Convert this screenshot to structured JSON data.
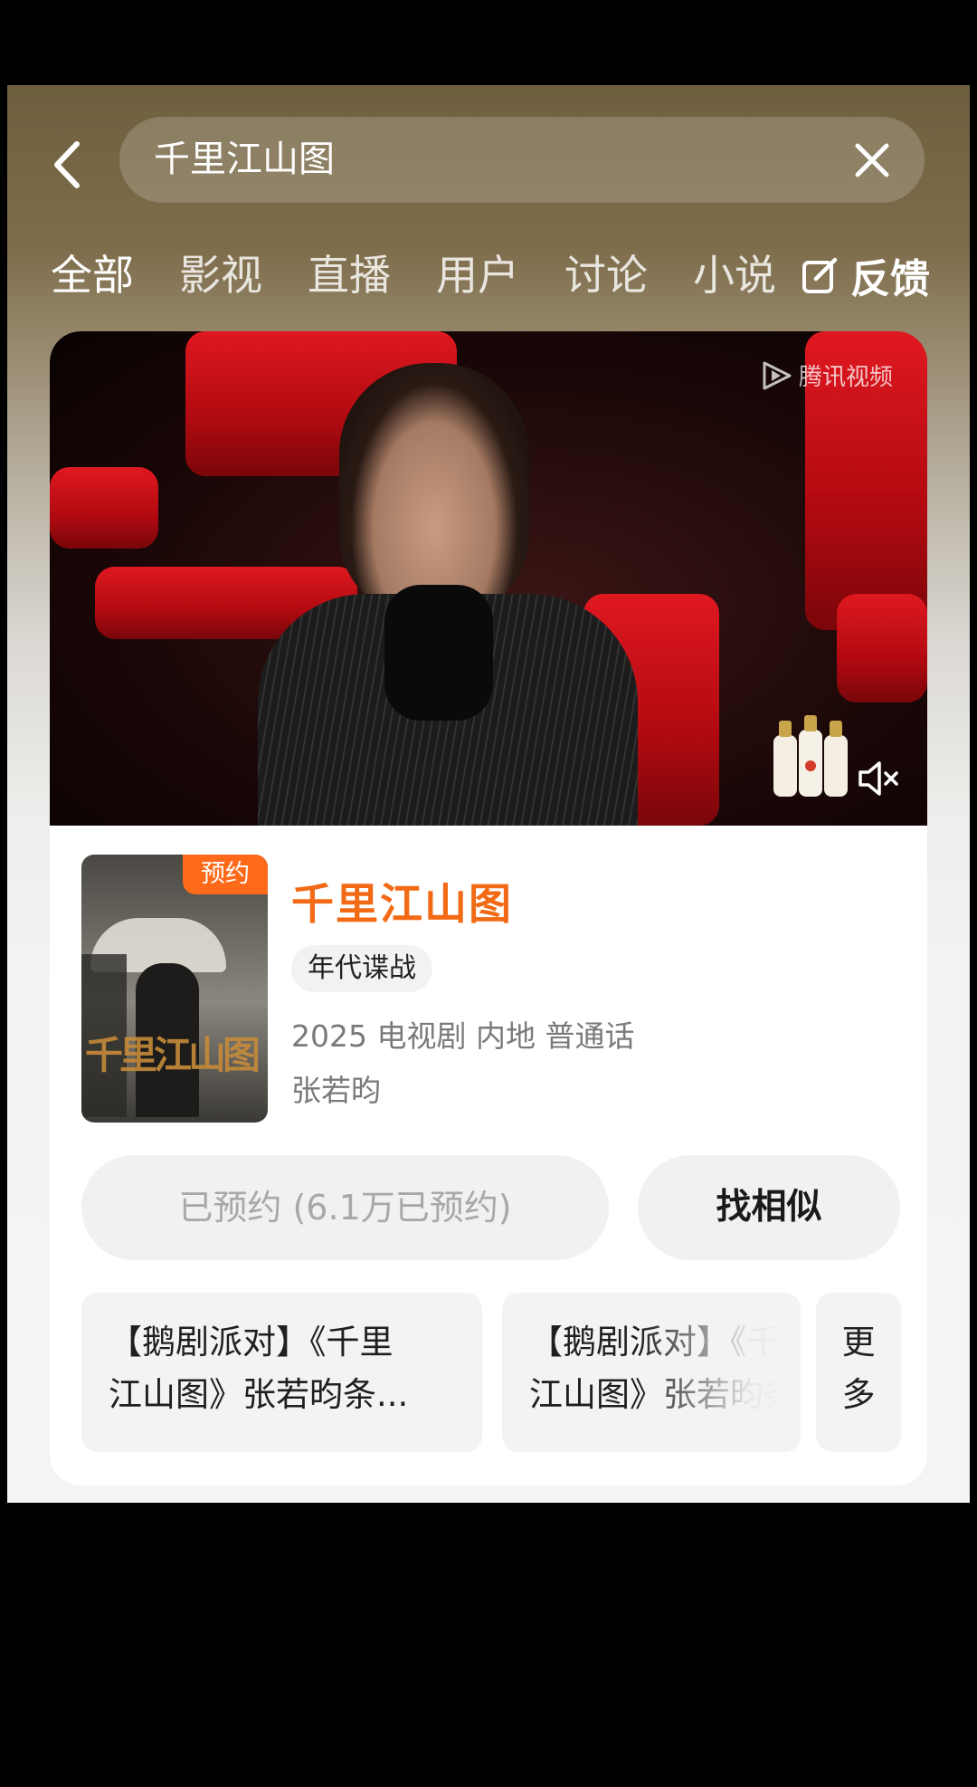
{
  "header": {
    "back_icon": "chevron-left-icon",
    "search_value": "千里江山图",
    "clear_icon": "close-icon"
  },
  "tabs": [
    "全部",
    "影视",
    "直播",
    "用户",
    "讨论",
    "小说"
  ],
  "feedback": {
    "icon": "edit-icon",
    "label": "反馈"
  },
  "video": {
    "watermark": "腾讯视频",
    "mute_icon": "speaker-muted-icon"
  },
  "show": {
    "poster_badge": "预约",
    "poster_title": "千里江山图",
    "title": "千里江山图",
    "tag": "年代谍战",
    "meta": "2025 电视剧 内地 普通话",
    "cast": "张若昀"
  },
  "actions": {
    "booked_label": "已预约 (6.1万已预约)",
    "similar_label": "找相似"
  },
  "episodes": [
    {
      "line1": "【鹅剧派对】《千里",
      "line2": "江山图》张若昀条..."
    },
    {
      "line1": "【鹅剧派对】《千里",
      "line2": "江山图》张若昀条..."
    }
  ],
  "more": {
    "line1": "更",
    "line2": "多"
  },
  "colors": {
    "accent": "#f26a15",
    "badge": "#ff6a1a"
  }
}
